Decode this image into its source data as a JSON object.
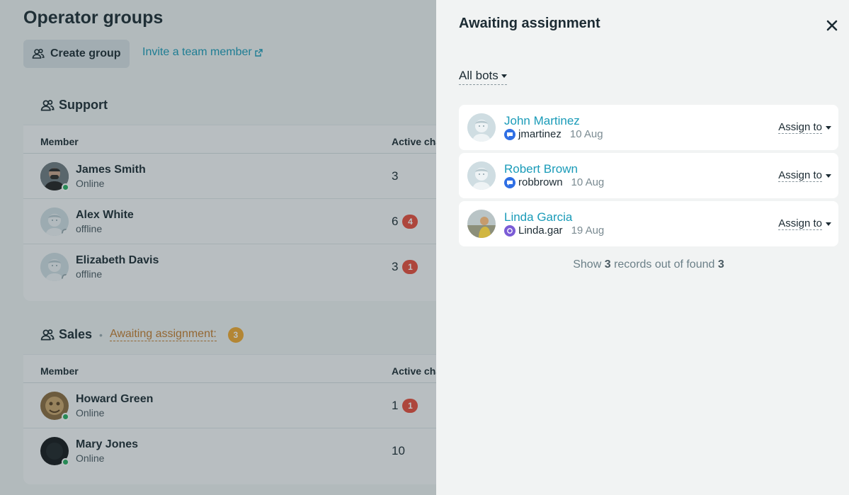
{
  "page": {
    "title": "Operator groups",
    "create_label": "Create group",
    "invite_label": "Invite a team member",
    "member_col": "Member",
    "active_col": "Active chats"
  },
  "groups": [
    {
      "name": "Support",
      "members": [
        {
          "name": "James Smith",
          "status": "Online",
          "chats": "3",
          "badge": ""
        },
        {
          "name": "Alex White",
          "status": "offline",
          "chats": "6",
          "badge": "4"
        },
        {
          "name": "Elizabeth Davis",
          "status": "offline",
          "chats": "3",
          "badge": "1"
        }
      ]
    },
    {
      "name": "Sales",
      "awaiting_label": "Awaiting assignment:",
      "awaiting_count": "3",
      "members": [
        {
          "name": "Howard Green",
          "status": "Online",
          "chats": "1",
          "badge": "1"
        },
        {
          "name": "Mary Jones",
          "status": "Online",
          "chats": "10",
          "badge": ""
        }
      ]
    }
  ],
  "drawer": {
    "title": "Awaiting assignment",
    "filter": "All bots",
    "assign_label": "Assign to",
    "records": [
      {
        "name": "John Martinez",
        "username": "jmartinez",
        "date": "10 Aug",
        "channel": "messenger-icon"
      },
      {
        "name": "Robert Brown",
        "username": "robbrown",
        "date": "10 Aug",
        "channel": "messenger-icon"
      },
      {
        "name": "Linda Garcia",
        "username": "Linda.gar",
        "date": "19 Aug",
        "channel": "viber-icon"
      }
    ],
    "summary_prefix": "Show",
    "summary_shown": "3",
    "summary_middle": "records out of found",
    "summary_total": "3"
  },
  "colors": {
    "accent": "#1a9bb8",
    "online": "#27ae60",
    "badge_red": "#e74c3c",
    "awaiting": "#c27c2f"
  }
}
